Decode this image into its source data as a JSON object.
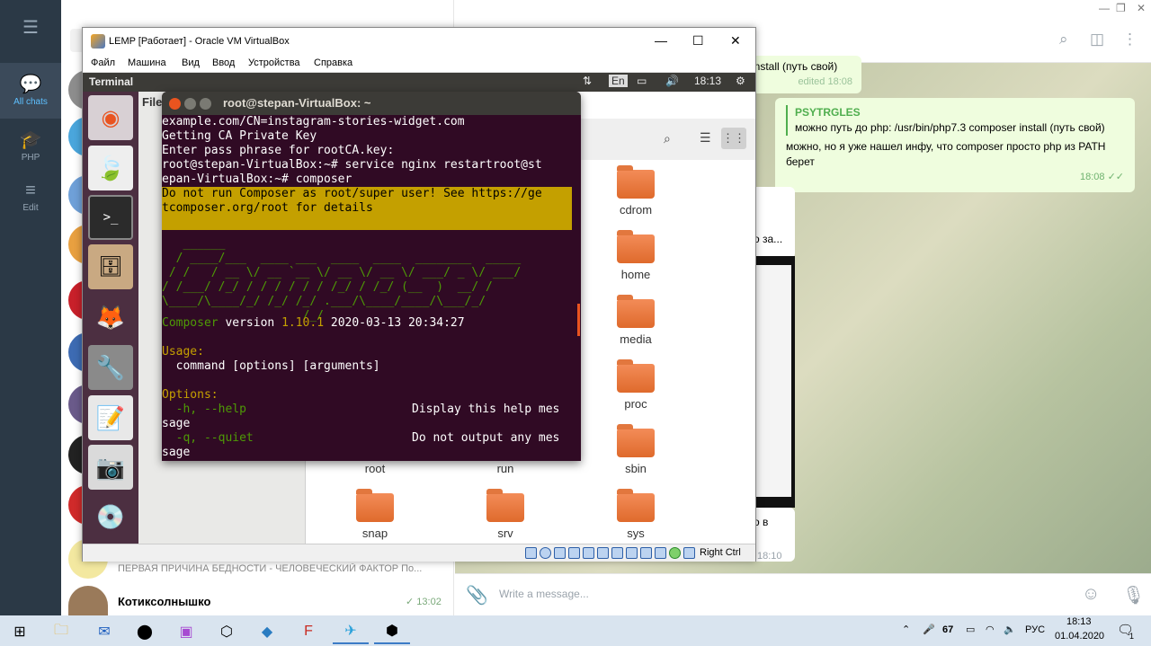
{
  "telegram": {
    "rail": [
      {
        "label": "All chats",
        "icon": "chats-icon"
      },
      {
        "label": "PHP",
        "icon": "folder-icon"
      },
      {
        "label": "Edit",
        "icon": "edit-icon"
      }
    ],
    "list_preview_text": "ПЕРВАЯ ПРИЧИНА БЕДНОСТИ - ЧЕЛОВЕЧЕСКИЙ ФАКТОР  По...",
    "last_chat": {
      "name": "Котиксолнышко",
      "time": "13:02"
    },
    "partial_msg": {
      "text": "install (путь свой)",
      "meta": "edited 18:08"
    },
    "bubble": {
      "reply_name": "PSYTRGLES",
      "reply_text": "можно путь до php: /usr/bin/php7.3 composer install (путь свой)",
      "text": "можно, но я уже нашел инфу, что composer просто php из PATH берет",
      "time": "18:08"
    },
    "side_snippets": {
      "a": "о за...",
      "b": "о в",
      "c": "18:10"
    },
    "input_placeholder": "Write a message..."
  },
  "vbox": {
    "title": "LEMP [Работает] - Oracle VM VirtualBox",
    "menu": [
      "Файл",
      "Машина",
      "Вид",
      "Ввод",
      "Устройства",
      "Справка"
    ],
    "status_right": "Right Ctrl"
  },
  "ubuntu": {
    "topbar_title": "Terminal",
    "lang": "En",
    "clock": "18:13",
    "fm_side_title": "File",
    "folders": [
      "cdrom",
      "home",
      "media",
      "proc",
      "sbin",
      "root",
      "run",
      "snap",
      "srv",
      "sys"
    ]
  },
  "terminal": {
    "title": "root@stepan-VirtualBox: ~",
    "lines": [
      "example.com/CN=instagram-stories-widget.com",
      "Getting CA Private Key",
      "Enter pass phrase for rootCA.key:",
      "root@stepan-VirtualBox:~# service nginx restartroot@st",
      "epan-VirtualBox:~# composer"
    ],
    "warning": [
      "Do not run Composer as root/super user! See https://ge",
      "tcomposer.org/root for details"
    ],
    "ascii_art": [
      "   ______",
      "  / ____/___  ____ ___  ____  ____  ________  _____",
      " / /   / __ \\/ __ `__ \\/ __ \\/ __ \\/ ___/ _ \\/ ___/",
      "/ /___/ /_/ / / / / / / /_/ / /_/ (__  )  __/ /",
      "\\____/\\____/_/ /_/ /_/ .___/\\____/____/\\___/_/",
      "                    /_/"
    ],
    "version_label": "Composer",
    "version_word": "version",
    "version": "1.10.1",
    "version_date": "2020-03-13 20:34:27",
    "usage_label": "Usage:",
    "usage": "  command [options] [arguments]",
    "options_label": "Options:",
    "opt1": "  -h, --help",
    "opt1_desc": "Display this help mes",
    "opt1_wrap": "sage",
    "opt2": "  -q, --quiet",
    "opt2_desc": "Do not output any mes",
    "opt2_wrap": "sage"
  },
  "taskbar": {
    "lang": "РУС",
    "time": "18:13",
    "date": "01.04.2020",
    "badge": "67",
    "notif": "1"
  },
  "colors": {
    "telegram_rail": "#2b3946",
    "ubuntu_purple": "#300a24",
    "warning_bg": "#c4a000",
    "folder_orange": "#e96f30"
  }
}
